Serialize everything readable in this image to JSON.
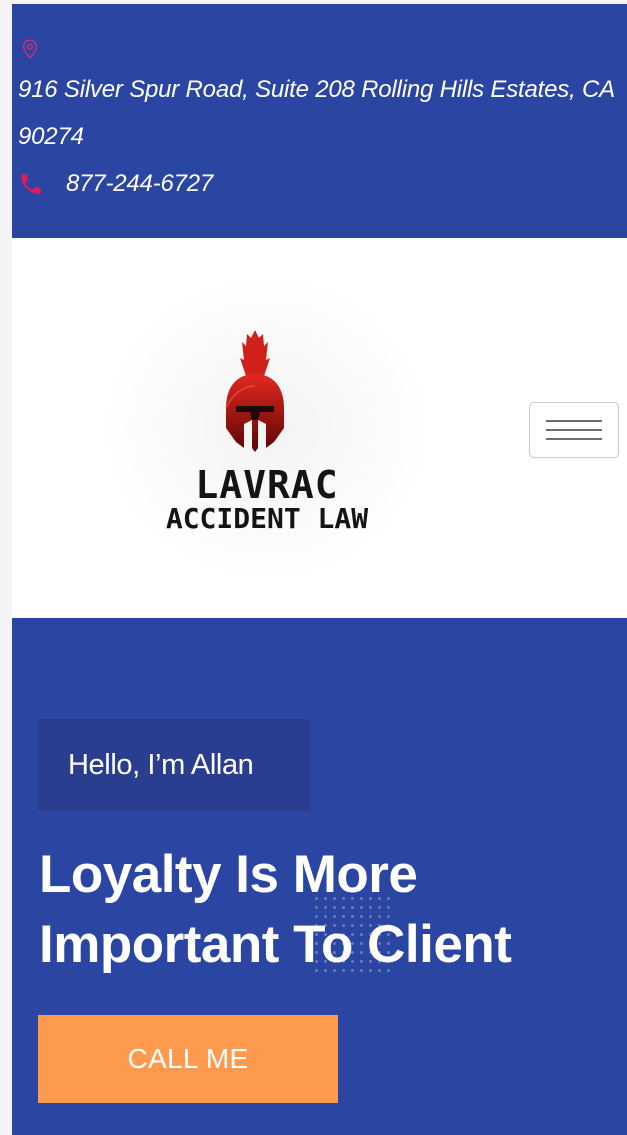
{
  "topbar": {
    "location_icon": "map-marker-icon",
    "address": "916 Silver Spur Road, Suite 208 Rolling Hills Estates, CA 90274",
    "phone_icon": "phone-icon",
    "phone": "877-244-6727",
    "background_color": "#2b45a2",
    "icon_color": "#e6195e"
  },
  "header": {
    "logo": {
      "line1": "LAVRAC",
      "line2": "ACCIDENT LAW",
      "emblem": "spartan-helmet-icon"
    },
    "menu_icon": "hamburger-menu-icon"
  },
  "hero": {
    "greeting": "Hello, I’m Allan",
    "headline": "Loyalty Is More Important To Client",
    "cta_label": "CALL ME",
    "background_color": "#2b45a2",
    "cta_color": "#fe9a4d"
  }
}
